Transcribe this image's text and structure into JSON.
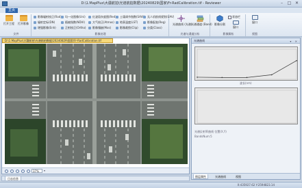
{
  "window": {
    "title": "D:\\1.MapPlus\\大疆航拍\\光谱航拍数据\\20240829\\国家\\Fr-RadCalibration.tif - Reviewer",
    "controls": [
      "–",
      "□",
      "✕"
    ]
  },
  "menu": {
    "active_tab": "主页"
  },
  "ribbon": {
    "file_group": {
      "label": "文件",
      "buttons": [
        {
          "label": "打开工程",
          "icon": "folder-icon"
        },
        {
          "label": "打开影像",
          "icon": "folder-icon"
        }
      ]
    },
    "processing_group": {
      "label": "影像处理",
      "columns": [
        [
          "影像辐射校正(Rad)",
          "辐射定标(DN)",
          "增强影像(Enh)"
        ],
        [
          "均一化图像(Uni)",
          "植被指数(NDVI)",
          "正射校正(Ortho)"
        ],
        [
          "红波段灰度图(Red)",
          "大气校正(Atmos)",
          "影像镶嵌(Mos)"
        ],
        [
          "土壤调节指数(SAVI)",
          "地表温度(LST)",
          "影像裁剪(Clip)"
        ],
        [
          "无人机航线规划(UAV)",
          "影像配准(Reg)",
          "分类(Class)"
        ]
      ]
    },
    "tools_group": {
      "label": "光谱与通道分析",
      "buttons": [
        {
          "label": "光谱曲线 (光谱)",
          "icon": "crosshair-icon"
        },
        {
          "label": "光谱通道 (Band)",
          "icon": "layers-icon"
        }
      ]
    },
    "analysis_group": {
      "label": "影像解析",
      "buttons": [
        {
          "label": "影像分割",
          "icon": "hexagon-icon"
        },
        {
          "label": "窗口",
          "icon": "window-icon"
        }
      ],
      "checkboxes": [
        "状态栏",
        "工具栏"
      ]
    },
    "view_group": {
      "label": "视图",
      "buttons": [
        {
          "label": "窗口",
          "icon": "window-icon"
        }
      ]
    }
  },
  "viewer": {
    "tab_title": "D:\\1.MapPlus\\大疆航拍\\光谱航拍数据\\20240829\\国家\\Fr-RadCalibration.tif",
    "zoom": "37%"
  },
  "right_panel": {
    "title": "光谱曲线",
    "panel_buttons": "▾ ✕",
    "chart_top_xlabel": "波长(nm)",
    "chart_bottom_xlabel": "",
    "info_lines": [
      "光谱反射率曲线  位置(X,Y)",
      "BandsNum:5"
    ],
    "tabs": [
      "图层属性",
      "光谱曲线",
      "视图"
    ]
  },
  "log": {
    "tab": "日志信息"
  },
  "status": {
    "text": "X:435927.62 Y:2594823.14"
  },
  "chart_data": [
    {
      "type": "line",
      "title": "",
      "x": [
        1,
        2,
        3,
        4,
        5
      ],
      "series": [
        {
          "values": [
            0.07,
            0.06,
            0.06,
            0.15,
            0.62
          ]
        }
      ],
      "ylim": [
        0,
        1
      ],
      "color": "#333333"
    },
    {
      "type": "line",
      "title": "",
      "x": [],
      "series": [],
      "ylim": [
        0,
        1
      ]
    }
  ]
}
